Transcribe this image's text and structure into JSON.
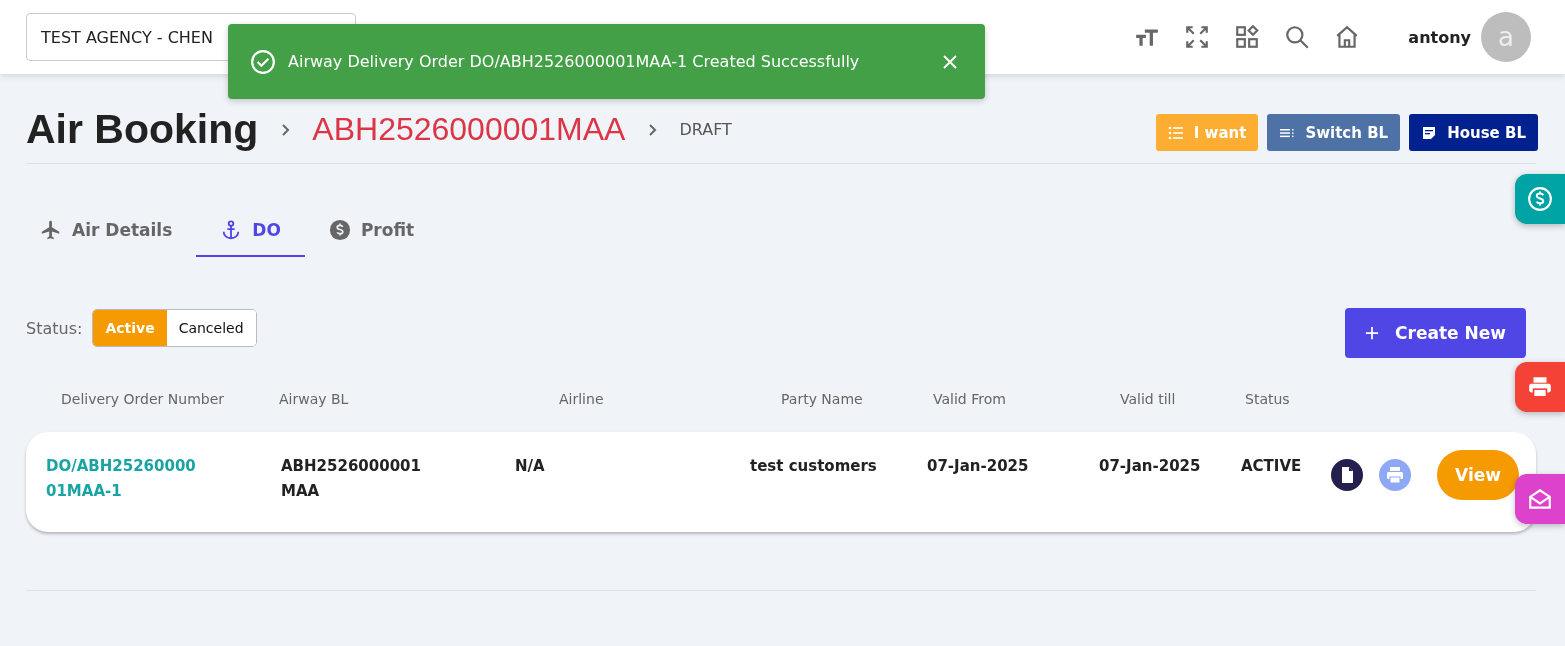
{
  "header": {
    "agency_select": "TEST AGENCY - CHEN",
    "user_name": "antony",
    "avatar_letter": "a"
  },
  "toast": {
    "message": "Airway Delivery Order DO/ABH2526000001MAA-1 Created Successfully"
  },
  "breadcrumb": {
    "title": "Air Booking",
    "booking_number": "ABH2526000001MAA",
    "state": "DRAFT"
  },
  "actions": [
    {
      "label": "I want",
      "kind": "list"
    },
    {
      "label": "Switch BL",
      "kind": "switch"
    },
    {
      "label": "House BL",
      "kind": "house"
    }
  ],
  "tabs": [
    {
      "label": "Air Details",
      "kind": "plane",
      "selected": false
    },
    {
      "label": "DO",
      "kind": "anchor",
      "selected": true
    },
    {
      "label": "Profit",
      "kind": "dollar",
      "selected": false
    }
  ],
  "status_filter": {
    "label": "Status:",
    "options": [
      {
        "label": "Active",
        "selected": true
      },
      {
        "label": "Canceled",
        "selected": false
      }
    ]
  },
  "create_button": "Create New",
  "table": {
    "columns": [
      "Delivery Order Number",
      "Airway BL",
      "Airline",
      "Party Name",
      "Valid From",
      "Valid till",
      "Status"
    ],
    "rows": [
      {
        "do_number": "DO/ABH25260000 01MAA-1",
        "airway_bl": "ABH2526000001 MAA",
        "airline": "N/A",
        "party_name": "test customers",
        "valid_from": "07-Jan-2025",
        "valid_till": "07-Jan-2025",
        "status": "ACTIVE",
        "action": "View"
      }
    ]
  }
}
